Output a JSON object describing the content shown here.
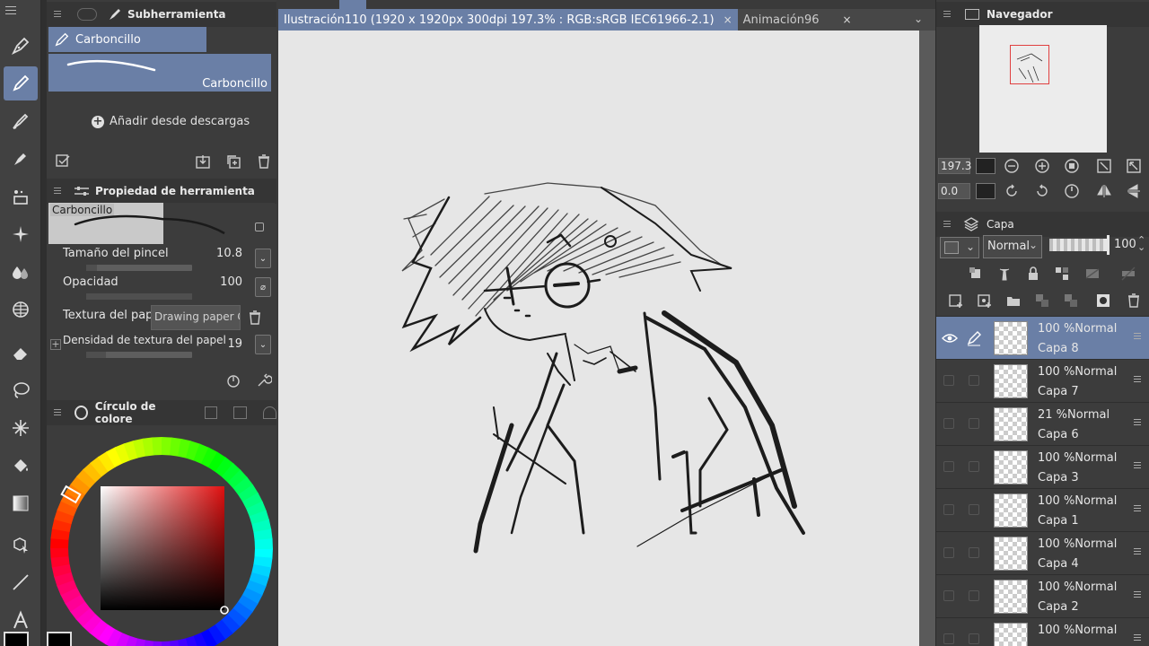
{
  "colors": {
    "accent": "#6a7fa6",
    "panel": "#3c3c3c",
    "paper": "#e6e6e6"
  },
  "subtool": {
    "title": "Subherramienta",
    "selected_brush": "Carboncillo",
    "preview_name": "Carboncillo",
    "add_label": "Añadir desde descargas"
  },
  "tool_property": {
    "title": "Propiedad de herramienta",
    "preview_name": "Carboncillo",
    "brush_size_label": "Tamaño del pincel",
    "brush_size_value": "10.8",
    "brush_size_level": 0.1,
    "opacity_label": "Opacidad",
    "opacity_value": "100",
    "opacity_level": 1.0,
    "texture_label": "Textura del papel",
    "texture_value": "Drawing paper C",
    "density_label": "Densidad de textura del papel",
    "density_value": "19",
    "density_level": 0.19
  },
  "color_panel": {
    "title": "Círculo de colore"
  },
  "canvas": {
    "tab_active": "Ilustración110 (1920 x 1920px 300dpi 197.3% : RGB:sRGB IEC61966-2.1)",
    "tab_other": "Animación96",
    "close_glyph": "×",
    "chevron_glyph": "⌄"
  },
  "navigator": {
    "title": "Navegador",
    "zoom": "197.3",
    "rotation": "0.0"
  },
  "layers": {
    "title": "Capa",
    "blend_mode": "Normal",
    "opacity": "100",
    "items": [
      {
        "mode": "100 %Normal",
        "name": "Capa 8",
        "selected": true
      },
      {
        "mode": "100 %Normal",
        "name": "Capa 7"
      },
      {
        "mode": "21 %Normal",
        "name": "Capa 6"
      },
      {
        "mode": "100 %Normal",
        "name": "Capa 3"
      },
      {
        "mode": "100 %Normal",
        "name": "Capa 1"
      },
      {
        "mode": "100 %Normal",
        "name": "Capa 4"
      },
      {
        "mode": "100 %Normal",
        "name": "Capa 2"
      },
      {
        "mode": "100 %Normal",
        "name": ""
      }
    ]
  }
}
